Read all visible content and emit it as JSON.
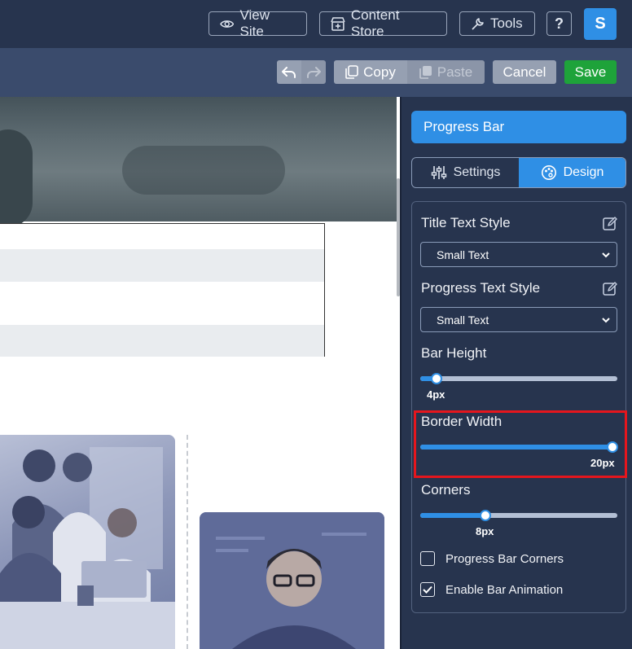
{
  "topbar": {
    "view_site": "View Site",
    "content_store": "Content Store",
    "tools": "Tools",
    "help": "?",
    "avatar_initial": "S"
  },
  "toolbar": {
    "copy": "Copy",
    "paste": "Paste",
    "cancel": "Cancel",
    "save": "Save"
  },
  "panel": {
    "block_title": "Progress Bar",
    "tabs": {
      "settings": "Settings",
      "design": "Design"
    },
    "active_tab": "Design",
    "title_text_style": {
      "label": "Title Text Style",
      "value": "Small Text"
    },
    "progress_text_style": {
      "label": "Progress Text Style",
      "value": "Small Text"
    },
    "bar_height": {
      "label": "Bar Height",
      "value": "4px",
      "level": 0.08
    },
    "border_width": {
      "label": "Border Width",
      "value": "20px",
      "level": 1.0
    },
    "corners": {
      "label": "Corners",
      "value": "8px",
      "level": 0.33
    },
    "progress_bar_corners": {
      "label": "Progress Bar Corners",
      "checked": false
    },
    "enable_bar_animation": {
      "label": "Enable Bar Animation",
      "checked": true
    }
  },
  "colors": {
    "topbar_bg": "#27344e",
    "toolbar_bg": "#3a4b6c",
    "accent": "#2f8fe5",
    "save": "#1ea33a",
    "highlight": "#e5161d"
  }
}
